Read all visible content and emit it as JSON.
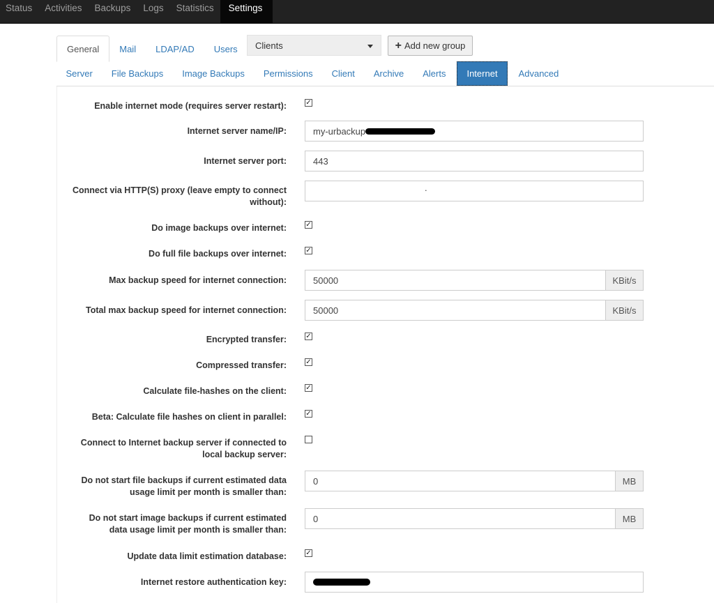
{
  "nav": {
    "items": [
      "Status",
      "Activities",
      "Backups",
      "Logs",
      "Statistics",
      "Settings"
    ],
    "active": "Settings"
  },
  "top_tabs": [
    "General",
    "Mail",
    "LDAP/AD",
    "Users"
  ],
  "clients_select": {
    "value": "Clients"
  },
  "add_group_button": {
    "label": "Add new group"
  },
  "sub_tabs": [
    "Server",
    "File Backups",
    "Image Backups",
    "Permissions",
    "Client",
    "Archive",
    "Alerts",
    "Internet",
    "Advanced"
  ],
  "active_sub_tab": "Internet",
  "form": {
    "enable_internet_mode": {
      "label": "Enable internet mode (requires server restart):",
      "checked": true
    },
    "server_name": {
      "label": "Internet server name/IP:",
      "value": "my-urbackup"
    },
    "server_port": {
      "label": "Internet server port:",
      "value": "443"
    },
    "proxy": {
      "label_line1": "Connect via HTTP(S) proxy (leave empty to connect",
      "label_line2": "without):",
      "value": "."
    },
    "image_backups_internet": {
      "label": "Do image backups over internet:",
      "checked": true
    },
    "full_file_backups_internet": {
      "label": "Do full file backups over internet:",
      "checked": true
    },
    "max_speed": {
      "label": "Max backup speed for internet connection:",
      "value": "50000",
      "unit": "KBit/s"
    },
    "total_max_speed": {
      "label": "Total max backup speed for internet connection:",
      "value": "50000",
      "unit": "KBit/s"
    },
    "encrypted": {
      "label": "Encrypted transfer:",
      "checked": true
    },
    "compressed": {
      "label": "Compressed transfer:",
      "checked": true
    },
    "hashes_client": {
      "label": "Calculate file-hashes on the client:",
      "checked": true
    },
    "hashes_parallel": {
      "label": "Beta: Calculate file hashes on client in parallel:",
      "checked": true
    },
    "connect_if_local": {
      "label_line1": "Connect to Internet backup server if connected to",
      "label_line2": "local backup server:",
      "checked": false
    },
    "file_limit": {
      "label_line1": "Do not start file backups if current estimated data",
      "label_line2": "usage limit per month is smaller than:",
      "value": "0",
      "unit": "MB"
    },
    "image_limit": {
      "label_line1": "Do not start image backups if current estimated",
      "label_line2": "data usage limit per month is smaller than:",
      "value": "0",
      "unit": "MB"
    },
    "update_db": {
      "label": "Update data limit estimation database:",
      "checked": true
    },
    "restore_key": {
      "label": "Internet restore authentication key:",
      "value": ""
    }
  }
}
